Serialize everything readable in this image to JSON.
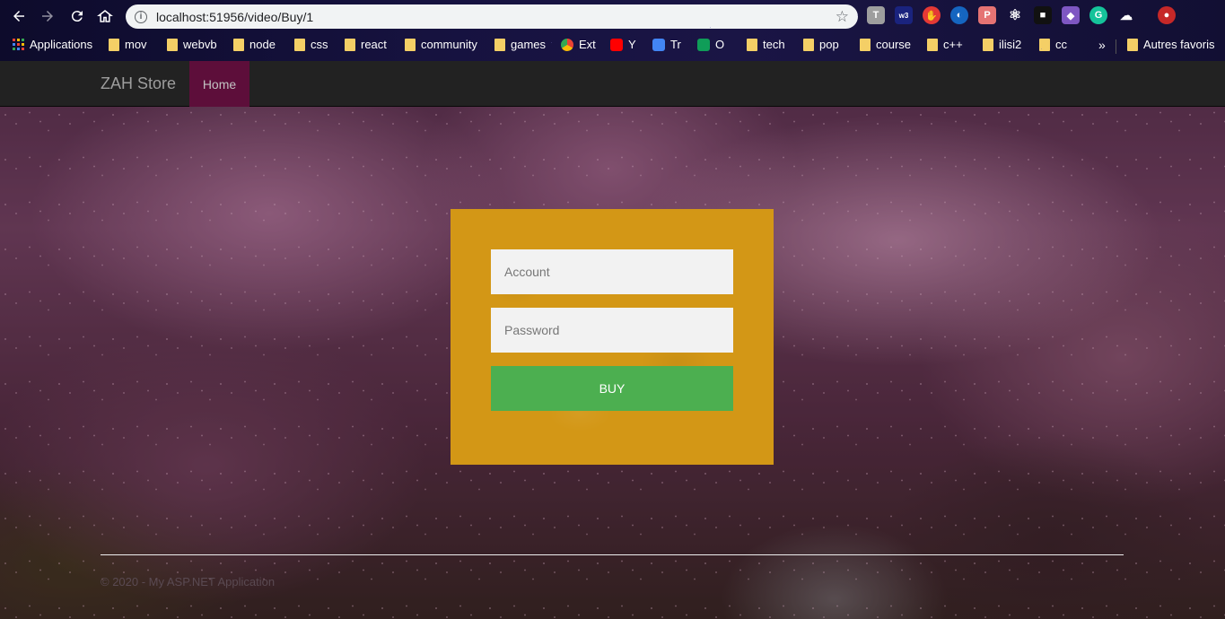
{
  "browser": {
    "url": "localhost:51956/video/Buy/1",
    "extensions": [
      "translate-icon",
      "w3-icon",
      "adblock-icon",
      "vpn-icon",
      "pdf-icon",
      "react-devtools-icon",
      "cube-icon",
      "game-icon",
      "grammarly-icon",
      "incognito-icon",
      "profile-avatar"
    ],
    "bookmarks": [
      {
        "label": "Applications",
        "icon": "apps-grid-icon"
      },
      {
        "label": "mov",
        "icon": "folder-icon"
      },
      {
        "label": "webvb",
        "icon": "folder-icon"
      },
      {
        "label": "node",
        "icon": "folder-icon"
      },
      {
        "label": "css",
        "icon": "folder-icon"
      },
      {
        "label": "react",
        "icon": "folder-icon"
      },
      {
        "label": "community",
        "icon": "folder-icon"
      },
      {
        "label": "games",
        "icon": "folder-icon"
      },
      {
        "label": "Ext",
        "icon": "chrome-icon"
      },
      {
        "label": "Y",
        "icon": "youtube-icon"
      },
      {
        "label": "Tr",
        "icon": "translate-icon"
      },
      {
        "label": "O",
        "icon": "o-icon"
      },
      {
        "label": "tech",
        "icon": "folder-icon"
      },
      {
        "label": "pop",
        "icon": "folder-icon"
      },
      {
        "label": "course",
        "icon": "folder-icon"
      },
      {
        "label": "c++",
        "icon": "folder-icon"
      },
      {
        "label": "ilisi2",
        "icon": "folder-icon"
      },
      {
        "label": "cc",
        "icon": "folder-icon"
      }
    ],
    "more_bookmarks": "»",
    "other_bookmarks": "Autres favoris"
  },
  "navbar": {
    "brand": "ZAH Store",
    "home": "Home"
  },
  "form": {
    "account_placeholder": "Account",
    "password_placeholder": "Password",
    "buy_label": "BUY"
  },
  "footer": {
    "text": "© 2020 - My ASP.NET Application"
  },
  "colors": {
    "card": "#d39716",
    "buy_button": "#4caf50",
    "nav_active": "#5d0e3a",
    "navbar": "#222222"
  }
}
